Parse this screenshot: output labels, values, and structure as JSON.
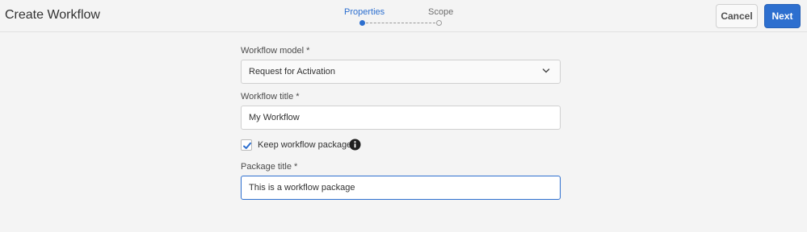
{
  "header": {
    "title": "Create Workflow",
    "steps": [
      {
        "label": "Properties",
        "active": true
      },
      {
        "label": "Scope",
        "active": false
      }
    ],
    "cancel_label": "Cancel",
    "next_label": "Next",
    "accent_color": "#2d6fcf"
  },
  "form": {
    "model": {
      "label": "Workflow model *",
      "value": "Request for Activation",
      "icon": "chevron-down-icon"
    },
    "title": {
      "label": "Workflow title *",
      "value": "My Workflow"
    },
    "keep_package": {
      "label": "Keep workflow package",
      "checked": true,
      "info_icon": "info-icon"
    },
    "package_title": {
      "label": "Package title *",
      "value": "This is a workflow package",
      "focused": true
    }
  }
}
